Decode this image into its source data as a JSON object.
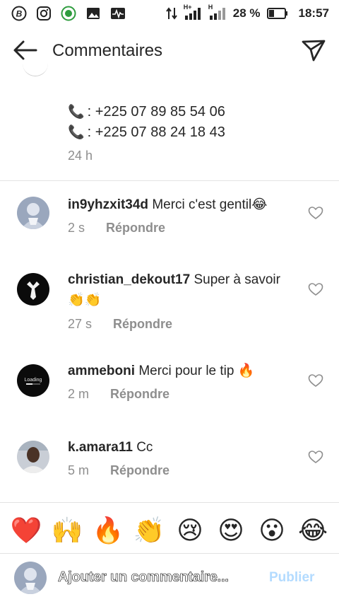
{
  "status_bar": {
    "battery_percent": "28 %",
    "time": "18:57",
    "network_1": "H+",
    "network_2": "H",
    "icons": [
      "b-circle-icon",
      "instagram-icon",
      "whatsapp-business-icon",
      "gallery-icon",
      "pulse-icon",
      "data-transfer-icon",
      "signal-icon",
      "signal-icon",
      "battery-icon"
    ]
  },
  "header": {
    "title": "Commentaires"
  },
  "caption": {
    "phone_1": ": +225 07 89 85 54 06",
    "phone_2": ": +225 07 88 24 18 43",
    "time": "24 h"
  },
  "comments": [
    {
      "username": "in9yhzxit34d",
      "text": "Merci c'est gentil😂",
      "time": "2 s",
      "reply": "Répondre"
    },
    {
      "username": "christian_dekout17",
      "text": "Super à savoir 👏👏",
      "time": "27 s",
      "reply": "Répondre"
    },
    {
      "username": "ammeboni",
      "text": "Merci pour le tip 🔥",
      "time": "2 m",
      "reply": "Répondre",
      "avatar_text": "Loading"
    },
    {
      "username": "k.amara11",
      "text": "Cc",
      "time": "5 m",
      "reply": "Répondre"
    }
  ],
  "emoji_bar": [
    "❤️",
    "🙌",
    "🔥",
    "👏",
    "😢",
    "😍",
    "😮",
    "😂"
  ],
  "input_bar": {
    "placeholder": "Ajouter un commentaire...",
    "publish_label": "Publier"
  },
  "colors": {
    "secondary_text": "#8e8e8e",
    "publish_disabled": "#b3dbff",
    "divider": "#e3e3e3"
  }
}
